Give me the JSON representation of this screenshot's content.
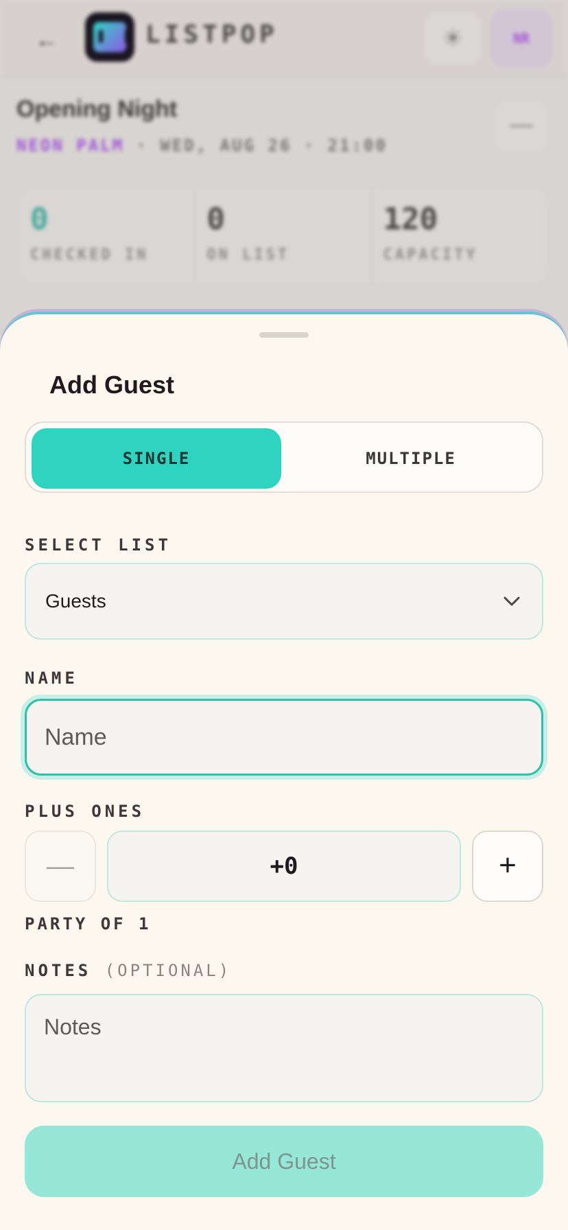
{
  "app": {
    "brand": "LISTPOP",
    "back_icon": "←",
    "theme_icon": "☀",
    "avatar_initials": "NR"
  },
  "event": {
    "title": "Opening Night",
    "venue": "NEON PALM",
    "separator": " · ",
    "datetime": "WED, AUG 26 · 21:00",
    "more_icon": "—"
  },
  "stats": [
    {
      "value": "0",
      "label": "CHECKED IN"
    },
    {
      "value": "0",
      "label": "ON LIST"
    },
    {
      "value": "120",
      "label": "CAPACITY"
    }
  ],
  "sheet": {
    "title": "Add Guest",
    "modes": {
      "single": "SINGLE",
      "multiple": "MULTIPLE"
    },
    "select_label": "SELECT LIST",
    "select_value": "Guests",
    "name_label": "NAME",
    "name_placeholder": "Name",
    "plus_label": "PLUS ONES",
    "minus_symbol": "—",
    "plus_symbol": "+",
    "plus_value": "+0",
    "party": "PARTY OF 1",
    "notes_label": "NOTES",
    "notes_optional": "(OPTIONAL)",
    "notes_placeholder": "Notes",
    "submit": "Add Guest"
  },
  "colors": {
    "accent_teal": "#2fd4c0",
    "accent_purple": "#a057d8",
    "sheet_bg": "#fcf8ef",
    "submit_disabled": "#97e7d8"
  }
}
